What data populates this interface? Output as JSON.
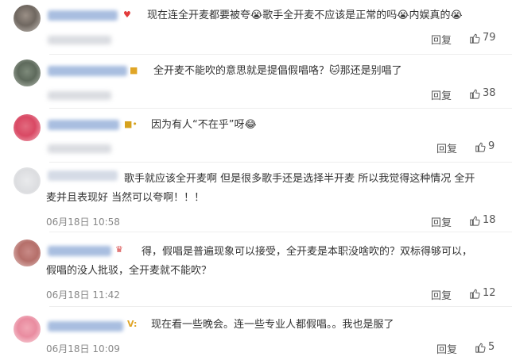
{
  "comments": [
    {
      "text_parts": [
        "现在连全开麦都要被夸",
        "歌手全开麦不应该是正常的吗",
        "内娱真的"
      ],
      "time": "",
      "reply": "回复",
      "likes": "79"
    },
    {
      "text_parts": [
        "全开麦不能吹的意思就是提倡假唱咯？",
        "那还是别唱了"
      ],
      "time": "",
      "reply": "回复",
      "likes": "38"
    },
    {
      "text_parts": [
        "因为有人“不在乎”呀"
      ],
      "time": "",
      "reply": "回复",
      "likes": "9"
    },
    {
      "text_line1": "歌手就应该全开麦啊 但是很多歌手还是选择半开麦 所以我觉得这种情况 全开",
      "text_line2": "麦并且表现好 当然可以夸啊！！！",
      "time": "06月18日 10:58",
      "reply": "回复",
      "likes": "18"
    },
    {
      "text_line1": "得，假唱是普遍现象可以接受，全开麦是本职没啥吹的？双标得够可以，",
      "text_line2": "假唱的没人批驳，全开麦就不能吹？",
      "time": "06月18日 11:42",
      "reply": "回复",
      "likes": "12"
    },
    {
      "text_parts": [
        "现在看一些晚会。连一些专业人都假唱。。我也是服了"
      ],
      "time": "06月18日 10:09",
      "reply": "回复",
      "likes": "5"
    }
  ],
  "icons": {
    "like": "thumb-up-icon",
    "emoji_crying": "crying-face-icon",
    "emoji_cat": "cat-face-icon",
    "emoji_laugh": "laughing-face-icon",
    "badge_vip": "vip-badge-icon",
    "badge_crown": "crown-badge-icon",
    "badge_v": "verified-badge-icon"
  }
}
